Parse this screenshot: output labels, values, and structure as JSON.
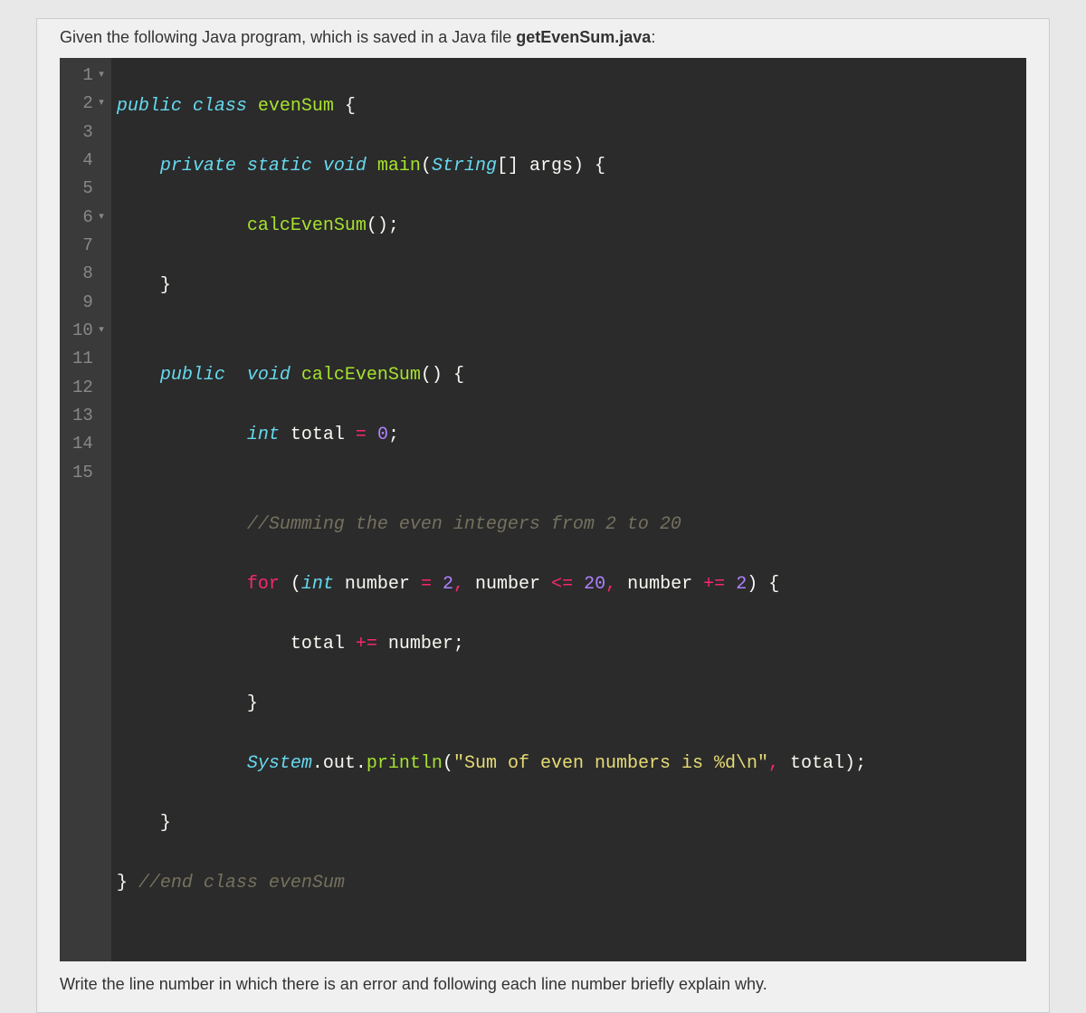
{
  "intro_pre": "Given the following Java program, which is saved in a Java file ",
  "filename": "getEvenSum.java",
  "intro_post": ":",
  "gutter": [
    "1",
    "2",
    "3",
    "4",
    "5",
    "6",
    "7",
    "8",
    "9",
    "10",
    "11",
    "12",
    "13",
    "14",
    "15"
  ],
  "fold": {
    "l1": "▾",
    "l2": "▾",
    "l6": "▾",
    "l10": "▾"
  },
  "code": {
    "l1": {
      "kw": "public",
      "kw2": "class",
      "name": "evenSum",
      "brace": "{"
    },
    "l2": {
      "kw": "private",
      "kw2": "static",
      "ret": "void",
      "fn": "main",
      "lparen": "(",
      "type": "String",
      "brackets": "[]",
      "arg": "args",
      "rparen": ")",
      "brace": "{"
    },
    "l3": {
      "fn": "calcEvenSum",
      "call": "();"
    },
    "l4": {
      "brace": "}"
    },
    "l5": {
      "empty": ""
    },
    "l6": {
      "kw": "public",
      "ret": "void",
      "fn": "calcEvenSum",
      "parens": "()",
      "brace": "{"
    },
    "l7": {
      "type": "int",
      "var": "total",
      "eq": "=",
      "num": "0",
      "semi": ";"
    },
    "l8": {
      "empty": ""
    },
    "l9": {
      "comment": "//Summing the even integers from 2 to 20"
    },
    "l10": {
      "kw": "for",
      "lparen": "(",
      "type": "int",
      "var": "number",
      "eq": "=",
      "num1": "2",
      "comma1": ",",
      "var2": "number",
      "cmp": "<=",
      "num2": "20",
      "comma2": ",",
      "var3": "number",
      "op": "+=",
      "num3": "2",
      "rparen": ")",
      "brace": "{"
    },
    "l11": {
      "var": "total",
      "op": "+=",
      "var2": "number",
      "semi": ";"
    },
    "l12": {
      "brace": "}"
    },
    "l13": {
      "sys": "System",
      "dot1": ".",
      "out": "out",
      "dot2": ".",
      "fn": "println",
      "lparen": "(",
      "str": "\"Sum of even numbers is %d\\n\"",
      "comma": ",",
      "var": "total",
      "rparen": ")",
      "semi": ";"
    },
    "l14": {
      "brace": "}"
    },
    "l15": {
      "brace": "}",
      "comment": "//end class evenSum"
    }
  },
  "prompt": "Write the line number in which there is an error and following each line number briefly explain why."
}
